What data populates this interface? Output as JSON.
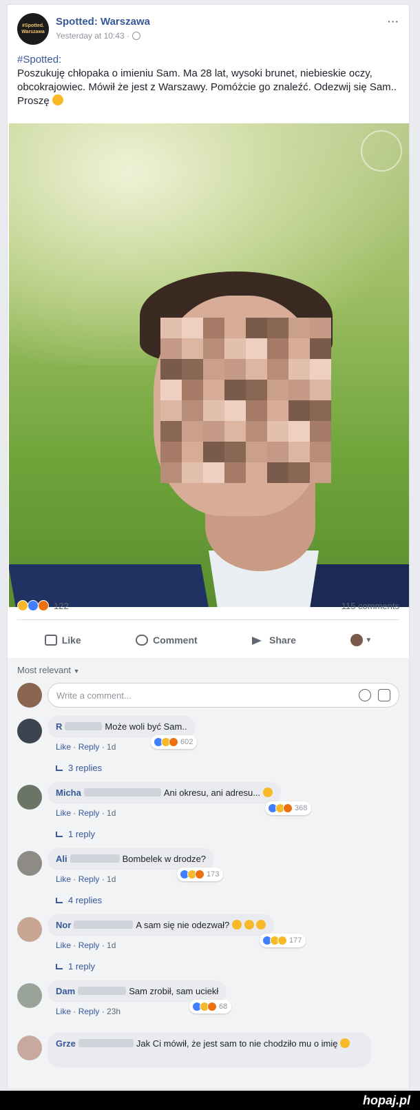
{
  "post": {
    "page_name": "Spotted: Warszawa",
    "avatar_text": "#Spotted. Warszawa",
    "time": "Yesterday at 10:43 ·",
    "more": "···",
    "hashtag": "#Spotted:",
    "body": "Poszukuję chłopaka o imieniu Sam. Ma 28 lat, wysoki brunet, niebieskie oczy, obcokrajowiec. Mówił że jest z Warszawy. Pomóżcie go znaleźć. Odezwij się Sam.. Proszę",
    "reactions_count": "122",
    "comments_count": "115 comments"
  },
  "actions": {
    "like": "Like",
    "comment": "Comment",
    "share": "Share"
  },
  "comments_section": {
    "filter": "Most relevant",
    "write_placeholder": "Write a comment..."
  },
  "comments": [
    {
      "name": "R",
      "text": "Może woli być Sam..",
      "meta_like": "Like",
      "meta_reply": "Reply",
      "age": "1d",
      "reactions": "602",
      "replies": "3 replies"
    },
    {
      "name": "Micha",
      "text": "Ani okresu, ani adresu...",
      "meta_like": "Like",
      "meta_reply": "Reply",
      "age": "1d",
      "reactions": "368",
      "replies": "1 reply"
    },
    {
      "name": "Ali",
      "text": "Bombelek w drodze?",
      "meta_like": "Like",
      "meta_reply": "Reply",
      "age": "1d",
      "reactions": "173",
      "replies": "4 replies"
    },
    {
      "name": "Nor",
      "text": "A sam się nie odezwał?",
      "meta_like": "Like",
      "meta_reply": "Reply",
      "age": "1d",
      "reactions": "177",
      "replies": "1 reply"
    },
    {
      "name": "Dam",
      "text": "Sam zrobił, sam uciekł",
      "meta_like": "Like",
      "meta_reply": "Reply",
      "age": "23h",
      "reactions": "68",
      "replies": ""
    },
    {
      "name": "Grze",
      "text": "Jak Ci mówił, że jest sam to nie chodziło mu o imię",
      "meta_like": "",
      "meta_reply": "",
      "age": "",
      "reactions": "",
      "replies": ""
    }
  ],
  "watermark": "hopaj.pl",
  "colors": {
    "link": "#365899",
    "meta": "#606770",
    "background": "#e9ebee"
  }
}
